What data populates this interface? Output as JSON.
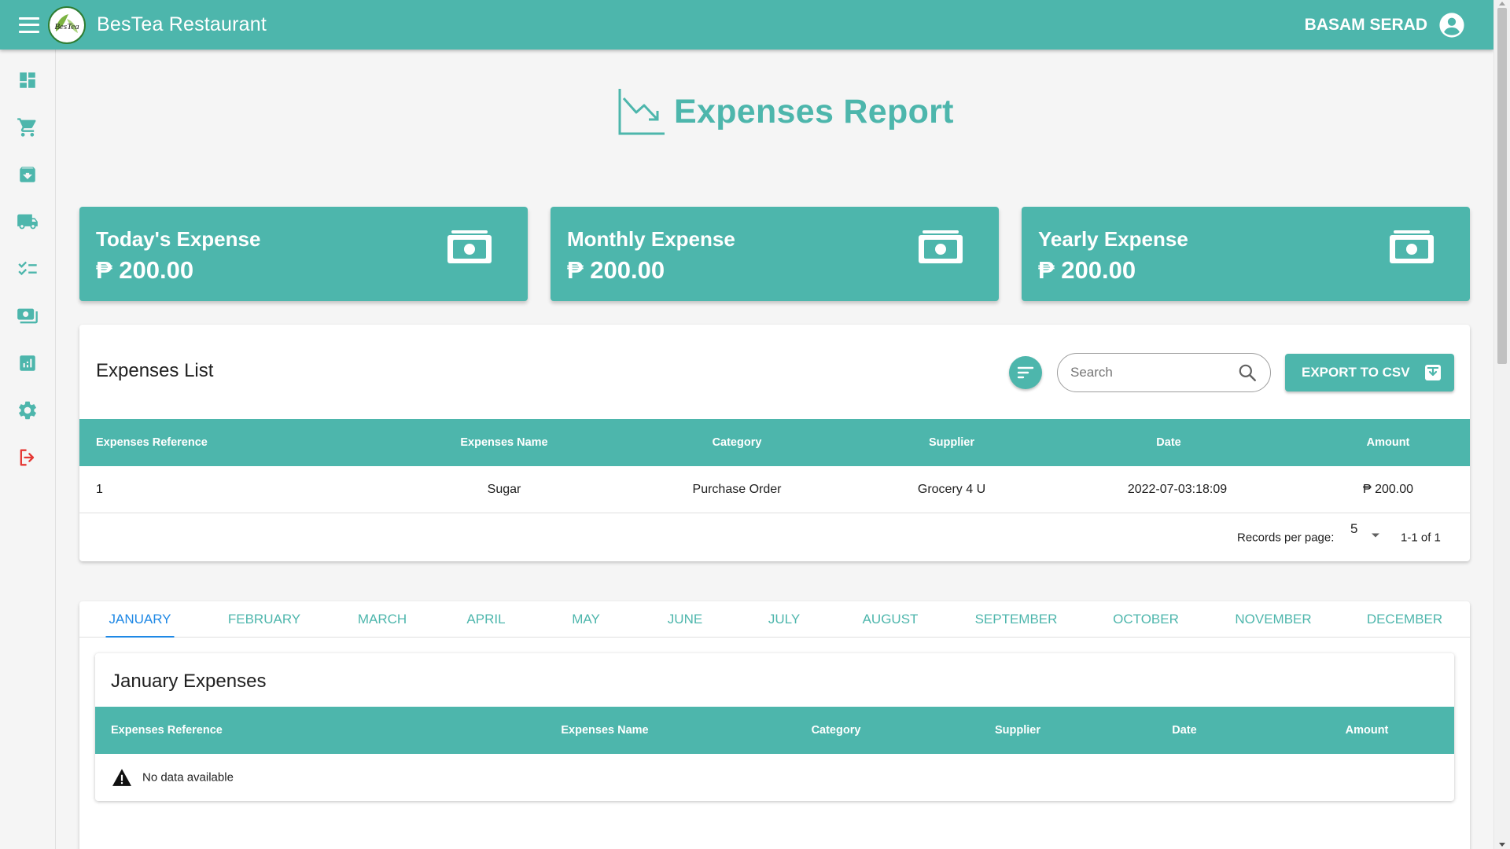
{
  "appbar": {
    "title": "BesTea Restaurant",
    "user_name": "BASAM SERAD",
    "logo_text": "BesTea"
  },
  "sidebar": {
    "items": [
      {
        "icon": "dashboard-icon"
      },
      {
        "icon": "cart-icon"
      },
      {
        "icon": "archive-icon"
      },
      {
        "icon": "truck-icon"
      },
      {
        "icon": "checklist-icon"
      },
      {
        "icon": "payments-icon"
      },
      {
        "icon": "analytics-icon"
      },
      {
        "icon": "gear-icon"
      },
      {
        "icon": "logout-icon"
      }
    ]
  },
  "page": {
    "title": "Expenses Report",
    "title_icon": "chart-down-icon"
  },
  "stats": [
    {
      "label": "Today's Expense",
      "value": "₱ 200.00",
      "icon": "cash-icon"
    },
    {
      "label": "Monthly Expense",
      "value": "₱ 200.00",
      "icon": "cash-icon"
    },
    {
      "label": "Yearly Expense",
      "value": "₱ 200.00",
      "icon": "cash-icon"
    }
  ],
  "expenses_list": {
    "title": "Expenses List",
    "search_placeholder": "Search",
    "export_label": "EXPORT TO CSV",
    "columns": [
      "Expenses Reference",
      "Expenses Name",
      "Category",
      "Supplier",
      "Date",
      "Amount"
    ],
    "rows": [
      {
        "reference": "1",
        "name": "Sugar",
        "category": "Purchase Order",
        "supplier": "Grocery 4 U",
        "date": "2022-07-03:18:09",
        "amount": "₱ 200.00"
      }
    ],
    "records_per_page_label": "Records per page:",
    "records_per_page": "5",
    "range_text": "1-1 of 1"
  },
  "months": {
    "tabs": [
      "JANUARY",
      "FEBRUARY",
      "MARCH",
      "APRIL",
      "MAY",
      "JUNE",
      "JULY",
      "AUGUST",
      "SEPTEMBER",
      "OCTOBER",
      "NOVEMBER",
      "DECEMBER"
    ],
    "active": "JANUARY",
    "panel_title": "January Expenses",
    "columns": [
      "Expenses Reference",
      "Expenses Name",
      "Category",
      "Supplier",
      "Date",
      "Amount"
    ],
    "empty_text": "No data available"
  },
  "colors": {
    "primary": "#4db6ac",
    "tab_active": "#1e88e5",
    "logout": "#e53935"
  }
}
